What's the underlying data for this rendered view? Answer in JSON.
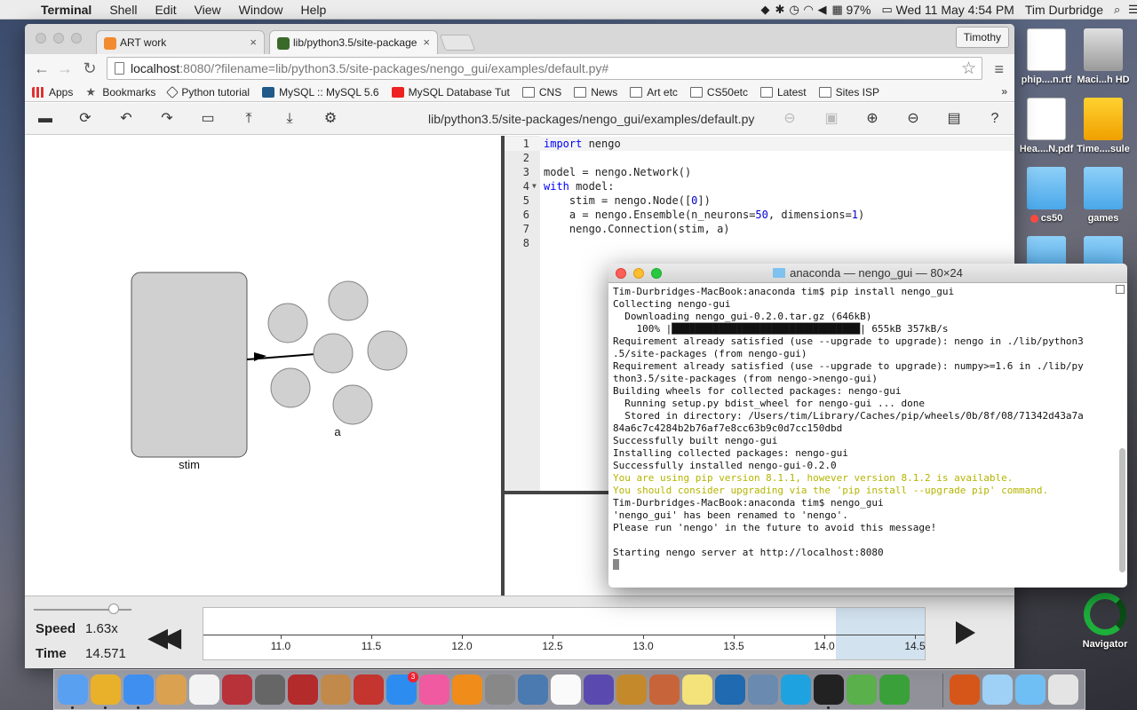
{
  "menubar": {
    "app": "Terminal",
    "items": [
      "Shell",
      "Edit",
      "View",
      "Window",
      "Help"
    ],
    "battery": "97%",
    "datetime": "Wed 11 May  4:54 PM",
    "user": "Tim Durbridge"
  },
  "desktop": {
    "icons": [
      {
        "label": "phip....n.rtf",
        "kind": "document"
      },
      {
        "label": "Maci...h HD",
        "kind": "hard-drive"
      },
      {
        "label": "Hea....N.pdf",
        "kind": "pdf"
      },
      {
        "label": "Time....sule",
        "kind": "time-capsule"
      },
      {
        "label": "cs50",
        "kind": "folder"
      },
      {
        "label": "games",
        "kind": "folder"
      }
    ],
    "navigator_label": "Navigator"
  },
  "browser": {
    "tabs": [
      {
        "title": "ART work",
        "active": false
      },
      {
        "title": "lib/python3.5/site-package",
        "active": true
      }
    ],
    "profile": "Timothy",
    "url_host": "localhost",
    "url_rest": ":8080/?filename=lib/python3.5/site-packages/nengo_gui/examples/default.py#",
    "bookmarks": [
      {
        "label": "Apps",
        "icon": "apps-grid-icon"
      },
      {
        "label": "Bookmarks",
        "icon": "star-icon"
      },
      {
        "label": "Python tutorial",
        "icon": "python-icon"
      },
      {
        "label": "MySQL :: MySQL 5.6",
        "icon": "mysql-icon"
      },
      {
        "label": "MySQL Database Tut",
        "icon": "youtube-icon"
      },
      {
        "label": "CNS",
        "icon": "folder-icon"
      },
      {
        "label": "News",
        "icon": "folder-icon"
      },
      {
        "label": "Art etc",
        "icon": "folder-icon"
      },
      {
        "label": "CS50etc",
        "icon": "folder-icon"
      },
      {
        "label": "Latest",
        "icon": "folder-icon"
      },
      {
        "label": "Sites ISP",
        "icon": "folder-icon"
      }
    ],
    "bookmarks_more": "»"
  },
  "nengo": {
    "filename": "lib/python3.5/site-packages/nengo_gui/examples/default.py",
    "graph": {
      "node_label": "stim",
      "ensemble_label": "a"
    },
    "code_lines": [
      {
        "n": "1",
        "html": "<span class=\"kw\">import</span> nengo"
      },
      {
        "n": "2",
        "html": ""
      },
      {
        "n": "3",
        "html": "model = nengo.Network()"
      },
      {
        "n": "4",
        "html": "<span class=\"kw\">with</span> model:",
        "fold": true
      },
      {
        "n": "5",
        "html": "    stim = nengo.Node([<span class=\"num\">0</span>])"
      },
      {
        "n": "6",
        "html": "    a = nengo.Ensemble(n_neurons=<span class=\"num\">50</span>, dimensions=<span class=\"num\">1</span>)"
      },
      {
        "n": "7",
        "html": "    nengo.Connection(stim, a)"
      },
      {
        "n": "8",
        "html": ""
      }
    ],
    "sim": {
      "speed_label": "Speed",
      "speed_value": "1.63x",
      "time_label": "Time",
      "time_value": "14.571",
      "ticks": [
        "11.0",
        "11.5",
        "12.0",
        "12.5",
        "13.0",
        "13.5",
        "14.0",
        "14.5"
      ]
    }
  },
  "terminal": {
    "title": "anaconda — nengo_gui — 80×24",
    "lines": [
      {
        "t": "Tim-Durbridges-MacBook:anaconda tim$ pip install nengo_gui",
        "style": ""
      },
      {
        "t": "Collecting nengo-gui",
        "style": ""
      },
      {
        "t": "  Downloading nengo_gui-0.2.0.tar.gz (646kB)",
        "style": ""
      },
      {
        "t": "    100% |████████████████████████████████| 655kB 357kB/s",
        "style": ""
      },
      {
        "t": "Requirement already satisfied (use --upgrade to upgrade): nengo in ./lib/python3",
        "style": ""
      },
      {
        "t": ".5/site-packages (from nengo-gui)",
        "style": ""
      },
      {
        "t": "Requirement already satisfied (use --upgrade to upgrade): numpy>=1.6 in ./lib/py",
        "style": ""
      },
      {
        "t": "thon3.5/site-packages (from nengo->nengo-gui)",
        "style": ""
      },
      {
        "t": "Building wheels for collected packages: nengo-gui",
        "style": ""
      },
      {
        "t": "  Running setup.py bdist_wheel for nengo-gui ... done",
        "style": ""
      },
      {
        "t": "  Stored in directory: /Users/tim/Library/Caches/pip/wheels/0b/8f/08/71342d43a7a",
        "style": ""
      },
      {
        "t": "84a6c7c4284b2b76af7e8cc63b9c0d7cc150dbd",
        "style": ""
      },
      {
        "t": "Successfully built nengo-gui",
        "style": ""
      },
      {
        "t": "Installing collected packages: nengo-gui",
        "style": ""
      },
      {
        "t": "Successfully installed nengo-gui-0.2.0",
        "style": ""
      },
      {
        "t": "You are using pip version 8.1.1, however version 8.1.2 is available.",
        "style": "warn"
      },
      {
        "t": "You should consider upgrading via the 'pip install --upgrade pip' command.",
        "style": "warn"
      },
      {
        "t": "Tim-Durbridges-MacBook:anaconda tim$ nengo_gui",
        "style": ""
      },
      {
        "t": "'nengo_gui' has been renamed to 'nengo'.",
        "style": ""
      },
      {
        "t": "Please run 'nengo' in the future to avoid this message!",
        "style": ""
      },
      {
        "t": "",
        "style": ""
      },
      {
        "t": "Starting nengo server at http://localhost:8080",
        "style": ""
      }
    ]
  },
  "dock": {
    "badge": "3",
    "apps": [
      "finder-icon",
      "chrome-icon",
      "safari-icon",
      "preview-icon",
      "photos-icon",
      "solitaire-icon",
      "launchpad-icon",
      "photo-booth-icon",
      "contacts-icon",
      "photo-icon",
      "app-store-icon",
      "itunes-icon",
      "ibooks-icon",
      "system-preferences-icon",
      "grapher-icon",
      "textedit-icon",
      "quill-icon",
      "dashboard-icon",
      "sketchbook-icon",
      "stickies-icon",
      "pse-icon",
      "scanner-icon",
      "skype-icon",
      "terminal-icon",
      "maps-icon",
      "evernote-icon"
    ],
    "trailing": [
      "bridge-icon",
      "folder-icon",
      "downloads-icon",
      "trash-icon"
    ]
  }
}
